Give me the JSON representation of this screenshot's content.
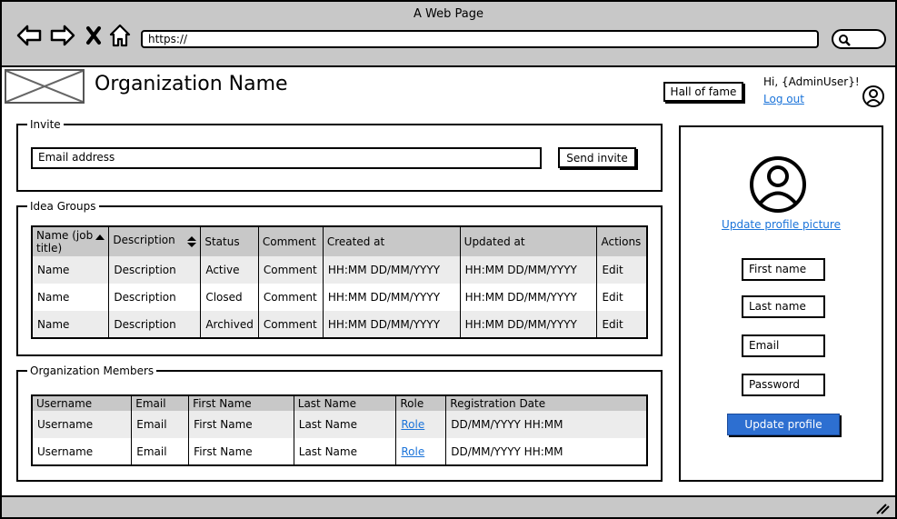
{
  "window": {
    "title": "A Web Page"
  },
  "browser": {
    "url": "https://"
  },
  "header": {
    "org_name": "Organization Name",
    "hall_of_fame": "Hall of fame",
    "greeting": "Hi, {AdminUser}!",
    "logout": "Log out"
  },
  "invite": {
    "legend": "Invite",
    "email_value": "Email address",
    "send_label": "Send invite"
  },
  "idea_groups": {
    "legend": "Idea Groups",
    "columns": [
      "Name (job title)",
      "Description",
      "Status",
      "Comment",
      "Created at",
      "Updated at",
      "Actions"
    ],
    "rows": [
      {
        "name": "Name",
        "description": "Description",
        "status": "Active",
        "comment": "Comment",
        "created": "HH:MM DD/MM/YYYY",
        "updated": "HH:MM DD/MM/YYYY",
        "action": "Edit"
      },
      {
        "name": "Name",
        "description": "Description",
        "status": "Closed",
        "comment": "Comment",
        "created": "HH:MM DD/MM/YYYY",
        "updated": "HH:MM DD/MM/YYYY",
        "action": "Edit"
      },
      {
        "name": "Name",
        "description": "Description",
        "status": "Archived",
        "comment": "Comment",
        "created": "HH:MM DD/MM/YYYY",
        "updated": "HH:MM DD/MM/YYYY",
        "action": "Edit"
      }
    ]
  },
  "members": {
    "legend": "Organization Members",
    "columns": [
      "Username",
      "Email",
      "First Name",
      "Last Name",
      "Role",
      "Registration Date"
    ],
    "rows": [
      {
        "username": "Username",
        "email": "Email",
        "first": "First Name",
        "last": "Last Name",
        "role": "Role",
        "date": "DD/MM/YYYY HH:MM"
      },
      {
        "username": "Username",
        "email": "Email",
        "first": "First Name",
        "last": "Last Name",
        "role": "Role",
        "date": "DD/MM/YYYY HH:MM"
      }
    ]
  },
  "profile": {
    "update_picture": "Update profile picture",
    "first_name": "First name",
    "last_name": "Last name",
    "email": "Email",
    "password": "Password",
    "update_button": "Update profile"
  },
  "colors": {
    "chrome": "#c8c8c8",
    "link": "#1a73d9",
    "primary": "#2d6fd1",
    "row_alt": "#ececec"
  },
  "icons": [
    "back-icon",
    "forward-icon",
    "close-icon",
    "home-icon",
    "search-icon",
    "user-icon",
    "sort-asc-icon",
    "sort-both-icon",
    "resize-grip-icon"
  ]
}
